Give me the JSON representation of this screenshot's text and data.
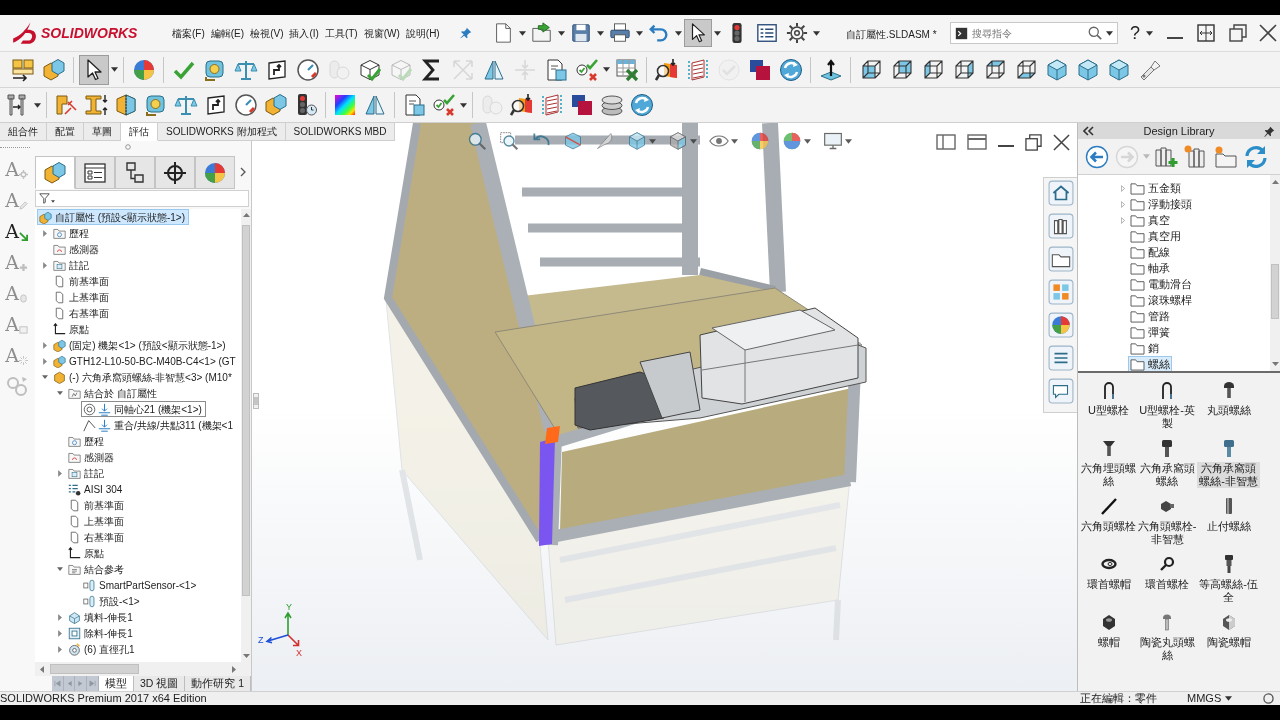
{
  "app_bar": {
    "logo": "SOLIDWORKS",
    "menu": [
      "檔案(F)",
      "編輯(E)",
      "檢視(V)",
      "插入(I)",
      "工具(T)",
      "視窗(W)",
      "說明(H)"
    ],
    "document_title": "自訂屬性.SLDASM *",
    "search": {
      "placeholder": "搜尋指令"
    },
    "help": "?"
  },
  "quick_access": [
    {
      "kind": "newdoc",
      "menu": true,
      "pressed": false,
      "disabled": false
    },
    {
      "kind": "open",
      "menu": true,
      "pressed": false,
      "disabled": false
    },
    {
      "kind": "save",
      "menu": true,
      "pressed": false,
      "disabled": false
    },
    {
      "kind": "print",
      "menu": true,
      "pressed": false,
      "disabled": false
    },
    {
      "kind": "undo",
      "menu": true,
      "pressed": false,
      "disabled": false
    },
    {
      "kind": "pointer",
      "menu": true,
      "pressed": true,
      "disabled": false
    },
    {
      "kind": "signal",
      "menu": false,
      "pressed": false,
      "disabled": false
    },
    {
      "kind": "options",
      "menu": false,
      "pressed": false,
      "disabled": false
    },
    {
      "kind": "gear",
      "menu": true,
      "pressed": false,
      "disabled": false
    }
  ],
  "toolbar_row_1": [
    [
      {
        "kind": "components",
        "menu": false,
        "pressed": false,
        "disabled": false
      },
      {
        "kind": "parts",
        "menu": false,
        "pressed": false,
        "disabled": false
      }
    ],
    [
      {
        "kind": "pointer",
        "menu": true,
        "pressed": true,
        "disabled": false
      }
    ],
    [
      {
        "kind": "appearance",
        "menu": false,
        "pressed": false,
        "disabled": false
      }
    ],
    [
      {
        "kind": "spell",
        "menu": false,
        "pressed": false,
        "disabled": false
      },
      {
        "kind": "measure",
        "menu": false,
        "pressed": false,
        "disabled": false
      },
      {
        "kind": "balance",
        "menu": false,
        "pressed": false,
        "disabled": false
      },
      {
        "kind": "section",
        "menu": false,
        "pressed": false,
        "disabled": false
      },
      {
        "kind": "gauge",
        "menu": false,
        "pressed": false,
        "disabled": false
      },
      {
        "kind": "interference",
        "menu": false,
        "pressed": false,
        "disabled": true
      },
      {
        "kind": "cubecheck",
        "menu": false,
        "pressed": false,
        "disabled": false
      },
      {
        "kind": "cubecheck",
        "menu": false,
        "pressed": false,
        "disabled": true
      },
      {
        "kind": "sigma",
        "menu": false,
        "pressed": false,
        "disabled": false
      },
      {
        "kind": "arrows",
        "menu": false,
        "pressed": false,
        "disabled": true
      },
      {
        "kind": "prism",
        "menu": false,
        "pressed": false,
        "disabled": false
      },
      {
        "kind": "compress",
        "menu": false,
        "pressed": false,
        "disabled": true
      },
      {
        "kind": "docquery",
        "menu": false,
        "pressed": false,
        "disabled": false
      },
      {
        "kind": "checkx",
        "menu": true,
        "pressed": false,
        "disabled": false
      },
      {
        "kind": "excel",
        "menu": false,
        "pressed": false,
        "disabled": false
      }
    ],
    [
      {
        "kind": "thickness",
        "menu": false,
        "pressed": false,
        "disabled": false
      },
      {
        "kind": "zebra",
        "menu": false,
        "pressed": false,
        "disabled": false
      },
      {
        "kind": "checkcircle",
        "menu": false,
        "pressed": false,
        "disabled": true
      },
      {
        "kind": "driveworks",
        "menu": false,
        "pressed": false,
        "disabled": false
      },
      {
        "kind": "recycle",
        "menu": false,
        "pressed": false,
        "disabled": false
      }
    ],
    [
      {
        "kind": "normal",
        "menu": false,
        "pressed": false,
        "disabled": false
      }
    ],
    [
      {
        "kind": "viewfront",
        "menu": false,
        "pressed": false,
        "disabled": false
      },
      {
        "kind": "viewback",
        "menu": false,
        "pressed": false,
        "disabled": false
      },
      {
        "kind": "viewleft",
        "menu": false,
        "pressed": false,
        "disabled": false
      },
      {
        "kind": "viewright",
        "menu": false,
        "pressed": false,
        "disabled": false
      },
      {
        "kind": "viewtop",
        "menu": false,
        "pressed": false,
        "disabled": false
      },
      {
        "kind": "viewbottom",
        "menu": false,
        "pressed": false,
        "disabled": false
      },
      {
        "kind": "viewiso",
        "menu": false,
        "pressed": false,
        "disabled": false
      },
      {
        "kind": "viewtri",
        "menu": false,
        "pressed": false,
        "disabled": false
      },
      {
        "kind": "viewdim",
        "menu": false,
        "pressed": false,
        "disabled": false
      },
      {
        "kind": "flashlight",
        "menu": false,
        "pressed": false,
        "disabled": false
      }
    ]
  ],
  "toolbar_row_2": [
    [
      {
        "kind": "bolts",
        "menu": true,
        "pressed": false,
        "disabled": false
      }
    ],
    [
      {
        "kind": "holewizard",
        "menu": false,
        "pressed": false,
        "disabled": false
      },
      {
        "kind": "ibeam",
        "menu": false,
        "pressed": false,
        "disabled": false
      },
      {
        "kind": "cubesplit",
        "menu": false,
        "pressed": false,
        "disabled": false
      },
      {
        "kind": "measure",
        "menu": false,
        "pressed": false,
        "disabled": false
      },
      {
        "kind": "balance",
        "menu": false,
        "pressed": false,
        "disabled": false
      },
      {
        "kind": "section",
        "menu": false,
        "pressed": false,
        "disabled": false
      },
      {
        "kind": "gauge",
        "menu": false,
        "pressed": false,
        "disabled": false
      },
      {
        "kind": "parts",
        "menu": false,
        "pressed": false,
        "disabled": false
      },
      {
        "kind": "traffic",
        "menu": false,
        "pressed": false,
        "disabled": false
      }
    ],
    [
      {
        "kind": "curvature",
        "menu": false,
        "pressed": false,
        "disabled": false
      },
      {
        "kind": "prism",
        "menu": false,
        "pressed": false,
        "disabled": false
      }
    ],
    [
      {
        "kind": "docquery",
        "menu": false,
        "pressed": false,
        "disabled": false
      },
      {
        "kind": "checkx",
        "menu": true,
        "pressed": false,
        "disabled": false
      }
    ],
    [
      {
        "kind": "interference",
        "menu": false,
        "pressed": false,
        "disabled": true
      },
      {
        "kind": "thickness",
        "menu": false,
        "pressed": false,
        "disabled": false
      },
      {
        "kind": "zebra",
        "menu": false,
        "pressed": false,
        "disabled": false
      },
      {
        "kind": "driveworks",
        "menu": false,
        "pressed": false,
        "disabled": false
      },
      {
        "kind": "coins",
        "menu": false,
        "pressed": false,
        "disabled": false
      },
      {
        "kind": "recycle",
        "menu": false,
        "pressed": false,
        "disabled": false
      }
    ]
  ],
  "command_tabs": [
    {
      "label": "組合件",
      "selected": false
    },
    {
      "label": "配置",
      "selected": false
    },
    {
      "label": "草圖",
      "selected": false
    },
    {
      "label": "評估",
      "selected": true
    },
    {
      "label": "SOLIDWORKS 附加程式",
      "selected": false
    },
    {
      "label": "SOLIDWORKS MBD",
      "selected": false
    }
  ],
  "side_tools": [
    {
      "kind": "gear",
      "label": "A",
      "enabled": false
    },
    {
      "kind": "pencil",
      "label": "A",
      "enabled": false
    },
    {
      "kind": "arrow",
      "label": "A",
      "enabled": true
    },
    {
      "kind": "plus",
      "label": "A",
      "enabled": false
    },
    {
      "kind": "tag",
      "label": "A",
      "enabled": false
    },
    {
      "kind": "sheet",
      "label": "A",
      "enabled": false
    },
    {
      "kind": "burst",
      "label": "A",
      "enabled": false
    },
    {
      "kind": "link",
      "enabled": false
    }
  ],
  "panel_tabs": [
    {
      "kind": "parts",
      "selected": true
    },
    {
      "kind": "property",
      "selected": false
    },
    {
      "kind": "config",
      "selected": false
    },
    {
      "kind": "dimxpert",
      "selected": false
    },
    {
      "kind": "appearance",
      "selected": false
    }
  ],
  "feature_tree": {
    "root": {
      "label": "自訂屬性 (預設<顯示狀態-1>)",
      "kind": "assembly",
      "selected": true,
      "hovered": false,
      "children": [
        {
          "label": "歷程",
          "kind": "history",
          "expanded": false,
          "selected": false,
          "hovered": false
        },
        {
          "label": "感測器",
          "kind": "sensors",
          "selected": false,
          "hovered": false
        },
        {
          "label": "註記",
          "kind": "notes",
          "expanded": false,
          "selected": false,
          "hovered": false
        },
        {
          "label": "前基準面",
          "kind": "plane",
          "selected": false,
          "hovered": false
        },
        {
          "label": "上基準面",
          "kind": "plane",
          "selected": false,
          "hovered": false
        },
        {
          "label": "右基準面",
          "kind": "plane",
          "selected": false,
          "hovered": false
        },
        {
          "label": "原點",
          "kind": "origin",
          "selected": false,
          "hovered": false
        },
        {
          "label": "(固定) 機架<1> (預設<顯示狀態-1>)",
          "kind": "assembly",
          "expanded": false,
          "selected": false,
          "hovered": false
        },
        {
          "label": "GTH12-L10-50-BC-M40B-C4<1> (GT",
          "kind": "assembly",
          "expanded": false,
          "selected": false,
          "hovered": false
        },
        {
          "label": "(-) 六角承窩頭螺絲-非智慧<3> (M10*",
          "kind": "part",
          "expanded": true,
          "selected": false,
          "hovered": false,
          "children": [
            {
              "label": "結合於 自訂屬性",
              "kind": "mates",
              "expanded": true,
              "selected": false,
              "hovered": false,
              "children": [
                {
                  "label": "同軸心21 (機架<1>)",
                  "kind": "concentric",
                  "selected": false,
                  "hovered": true
                },
                {
                  "label": "重合/共線/共點311 (機架<1",
                  "kind": "coincident",
                  "selected": false,
                  "hovered": false
                }
              ]
            },
            {
              "label": "歷程",
              "kind": "history",
              "selected": false,
              "hovered": false
            },
            {
              "label": "感測器",
              "kind": "sensors",
              "selected": false,
              "hovered": false
            },
            {
              "label": "註記",
              "kind": "notes",
              "expanded": false,
              "selected": false,
              "hovered": false
            },
            {
              "label": "AISI 304",
              "kind": "material",
              "selected": false,
              "hovered": false
            },
            {
              "label": "前基準面",
              "kind": "plane",
              "selected": false,
              "hovered": false
            },
            {
              "label": "上基準面",
              "kind": "plane",
              "selected": false,
              "hovered": false
            },
            {
              "label": "右基準面",
              "kind": "plane",
              "selected": false,
              "hovered": false
            },
            {
              "label": "原點",
              "kind": "origin",
              "selected": false,
              "hovered": false
            },
            {
              "label": "結合參考",
              "kind": "materef",
              "expanded": true,
              "selected": false,
              "hovered": false,
              "children": [
                {
                  "label": "SmartPartSensor-<1>",
                  "kind": "refitem",
                  "selected": false,
                  "hovered": false
                },
                {
                  "label": "預設-<1>",
                  "kind": "refitem",
                  "selected": false,
                  "hovered": false
                }
              ]
            },
            {
              "label": "填料-伸長1",
              "kind": "boss",
              "expanded": false,
              "selected": false,
              "hovered": false
            },
            {
              "label": "除料-伸長1",
              "kind": "cut",
              "expanded": false,
              "selected": false,
              "hovered": false
            },
            {
              "label": "(6) 直徑孔1",
              "kind": "hole",
              "expanded": false,
              "selected": false,
              "hovered": false
            }
          ]
        }
      ]
    }
  },
  "sheet_nav": [
    {
      "kind": "first",
      "disabled": true
    },
    {
      "kind": "prev2",
      "disabled": true
    },
    {
      "kind": "next",
      "disabled": true
    },
    {
      "kind": "last",
      "disabled": true
    }
  ],
  "bottom_tabs": [
    {
      "label": "模型",
      "selected": true
    },
    {
      "label": "3D 視圖",
      "selected": false
    },
    {
      "label": "動作研究 1",
      "selected": false
    }
  ],
  "triad": {
    "x": "X",
    "y": "Y",
    "z": "Z"
  },
  "design_library": {
    "title": "Design Library",
    "toolbar": [
      {
        "kind": "back",
        "menu": false,
        "pressed": false,
        "disabled": false
      },
      {
        "kind": "forward",
        "menu": true,
        "pressed": false,
        "disabled": true
      },
      {
        "kind": "addlib",
        "menu": false,
        "pressed": false,
        "disabled": false
      },
      {
        "kind": "newlib",
        "menu": false,
        "pressed": false,
        "disabled": false
      },
      {
        "kind": "newfolder",
        "menu": false,
        "pressed": false,
        "disabled": false
      },
      {
        "kind": "refresh",
        "menu": false,
        "pressed": false,
        "disabled": false
      }
    ],
    "folders": [
      {
        "label": "五金類",
        "expanded": false,
        "selected": false
      },
      {
        "label": "浮動接頭",
        "expanded": false,
        "selected": false
      },
      {
        "label": "真空",
        "expanded": false,
        "selected": false
      },
      {
        "label": "真空用",
        "selected": false
      },
      {
        "label": "配線",
        "selected": false
      },
      {
        "label": "軸承",
        "selected": false
      },
      {
        "label": "電動滑台",
        "selected": false
      },
      {
        "label": "滾珠螺桿",
        "selected": false
      },
      {
        "label": "管路",
        "selected": false
      },
      {
        "label": "彈簧",
        "selected": false
      },
      {
        "label": "銷",
        "selected": false
      },
      {
        "label": "螺絲",
        "selected": true
      }
    ],
    "items": [
      {
        "label": "U型螺栓",
        "kind": "ubolt",
        "selected": false
      },
      {
        "label": "U型螺栓-英製",
        "kind": "ubolt",
        "selected": false
      },
      {
        "label": "丸頭螺絲",
        "kind": "roundscrew",
        "selected": false
      },
      {
        "label": "六角埋頭螺絲",
        "kind": "countersunk",
        "selected": false
      },
      {
        "label": "六角承窩頭螺絲",
        "kind": "capscrew",
        "selected": false
      },
      {
        "label": "六角承窩頭螺絲-非智慧",
        "kind": "capscrewblue",
        "selected": true
      },
      {
        "label": "六角頭螺栓",
        "kind": "hexbolt",
        "selected": false
      },
      {
        "label": "六角頭螺栓-非智慧",
        "kind": "hexheadbolt",
        "selected": false
      },
      {
        "label": "止付螺絲",
        "kind": "setscrew",
        "selected": false
      },
      {
        "label": "環首螺帽",
        "kind": "eyenut",
        "selected": false
      },
      {
        "label": "環首螺栓",
        "kind": "eyebolt",
        "selected": false
      },
      {
        "label": "等高螺絲-伍全",
        "kind": "shoulder",
        "selected": false
      },
      {
        "label": "螺帽",
        "kind": "nut",
        "selected": false
      },
      {
        "label": "陶瓷丸頭螺絲",
        "kind": "ceramicscrew",
        "selected": false
      },
      {
        "label": "陶瓷螺帽",
        "kind": "ceramicnut",
        "selected": false
      }
    ]
  },
  "status_bar": {
    "product": "SOLIDWORKS Premium 2017 x64 Edition",
    "mode": "正在編輯：零件",
    "units": "MMGS"
  }
}
